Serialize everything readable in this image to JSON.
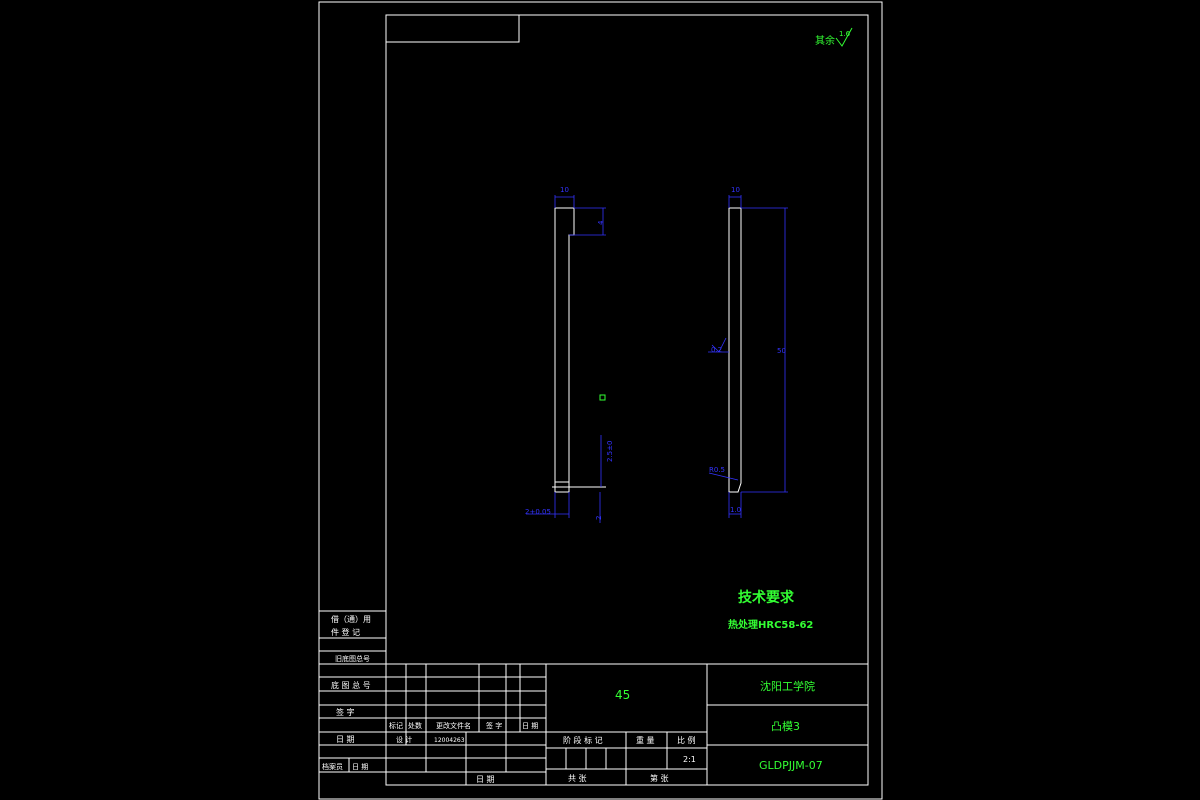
{
  "surface_finish": {
    "label": "其余",
    "value": "1.6"
  },
  "technical_requirements": {
    "title": "技术要求",
    "items": [
      "热处理HRC58-62"
    ]
  },
  "dimensions": {
    "front_top_width": "10",
    "front_notch_depth": "4",
    "front_diameter": "2.5±0",
    "front_bottom_tol": "2",
    "front_bottom_left": "2+0.05",
    "side_top_width": "10",
    "side_total_height": "50",
    "side_roughness": "0.2",
    "side_chamfer": "R0.5",
    "side_bottom_width": "1.0"
  },
  "title_block": {
    "material": "45",
    "institution": "沈阳工学院",
    "part_name": "凸模3",
    "drawing_number": "GLDPJJM-07",
    "scale": "2:1",
    "label_stage_mark": "阶 段 标 记",
    "label_weight": "重 量",
    "label_scale": "比 例",
    "label_total_sheets": "共   张",
    "label_sheet_no": "第   张",
    "rev_headers": [
      "标记",
      "处数",
      "更改文件名",
      "签 字",
      "日 期"
    ],
    "designer_label": "设 计",
    "designer_value": "12004263",
    "date_label": "日 期"
  },
  "side_column": {
    "borrow_label_1": "借（通）用",
    "borrow_label_2": "件 登 记",
    "old_drawing_no": "旧底图总号",
    "base_drawing_no": "底 图 总 号",
    "signature": "签    字",
    "date": "日    期",
    "archive": "档案员",
    "archive_date": "日 期"
  }
}
